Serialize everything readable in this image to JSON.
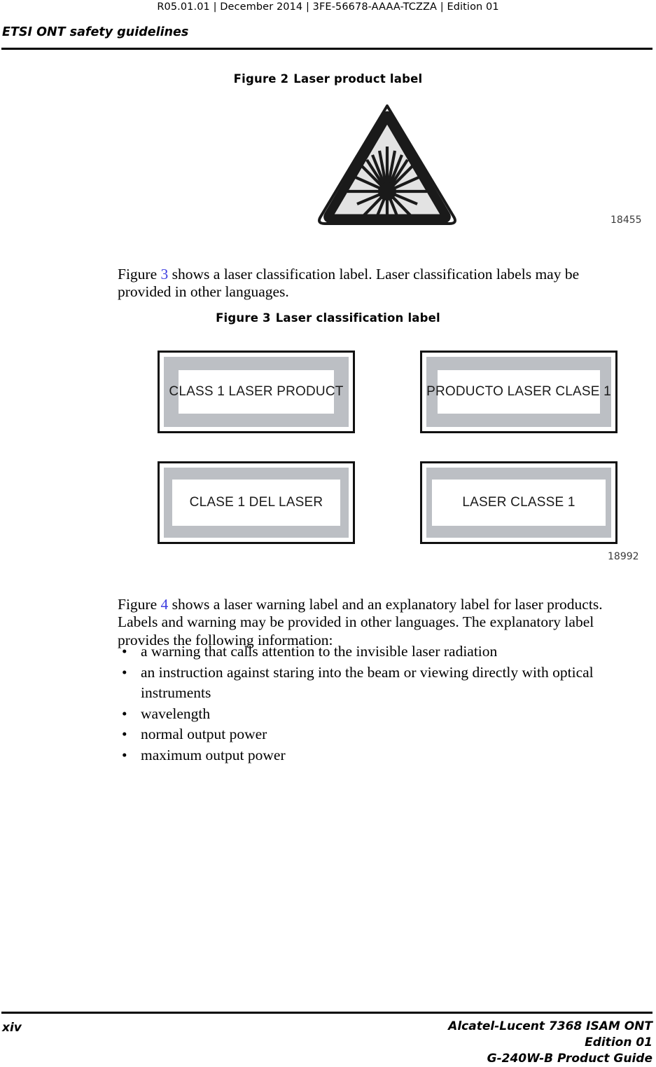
{
  "header": {
    "running_head": "R05.01.01 | December 2014 | 3FE-56678-AAAA-TCZZA | Edition 01",
    "chapter_title": "ETSI ONT safety guidelines"
  },
  "figures": [
    {
      "caption_number": "Figure 2",
      "caption_title": "Laser product label",
      "figure_id": "18455",
      "graphic": "laser-hazard-triangle-icon"
    },
    {
      "caption_number": "Figure 3",
      "caption_title": "Laser classification label",
      "figure_id": "18992",
      "plates": [
        {
          "text": "CLASS 1 LASER PRODUCT"
        },
        {
          "text": "PRODUCTO LASER CLASE 1"
        },
        {
          "text": "CLASE 1 DEL LASER"
        },
        {
          "text": "LASER CLASSE 1"
        }
      ]
    }
  ],
  "paragraphs": {
    "p1_before": "Figure ",
    "p1_xref": "3",
    "p1_after": " shows a laser classification label. Laser classification labels may be provided in other languages.",
    "p2_before": "Figure ",
    "p2_xref": "4",
    "p2_after": " shows a laser warning label and an explanatory label for laser products. Labels and warning may be provided in other languages. The explanatory label provides the following information:"
  },
  "bullets": [
    "a warning that calls attention to the invisible laser radiation",
    "an instruction against staring into the beam or viewing directly with optical instruments",
    "wavelength",
    "normal output power",
    "maximum output power"
  ],
  "bullet_glyph": "•",
  "footer": {
    "page_number": "xiv",
    "line1": "Alcatel-Lucent 7368 ISAM ONT",
    "line2": "Edition 01",
    "line3": "G-240W-B Product Guide"
  },
  "colors": {
    "xref_link": "#3d3de0",
    "plate_gray": "#bcbfc4",
    "hazard_fill": "#e3e3e3",
    "rule": "#000000"
  }
}
